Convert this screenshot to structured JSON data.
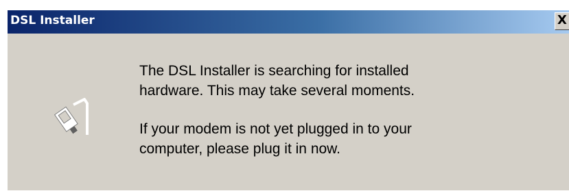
{
  "window": {
    "title": "DSL Installer",
    "close_label": "X",
    "colors": {
      "titlebar_start": "#0a246a",
      "titlebar_end": "#a6caf0",
      "face": "#d4d0c8"
    }
  },
  "icon": {
    "name": "usb-cable-icon"
  },
  "message": {
    "paragraph1": {
      "line1": "The DSL Installer is searching for installed",
      "line2": "hardware.  This may take several moments."
    },
    "paragraph2": {
      "line1": "If your modem is not yet plugged in to your",
      "line2": "computer, please plug it in now."
    }
  }
}
